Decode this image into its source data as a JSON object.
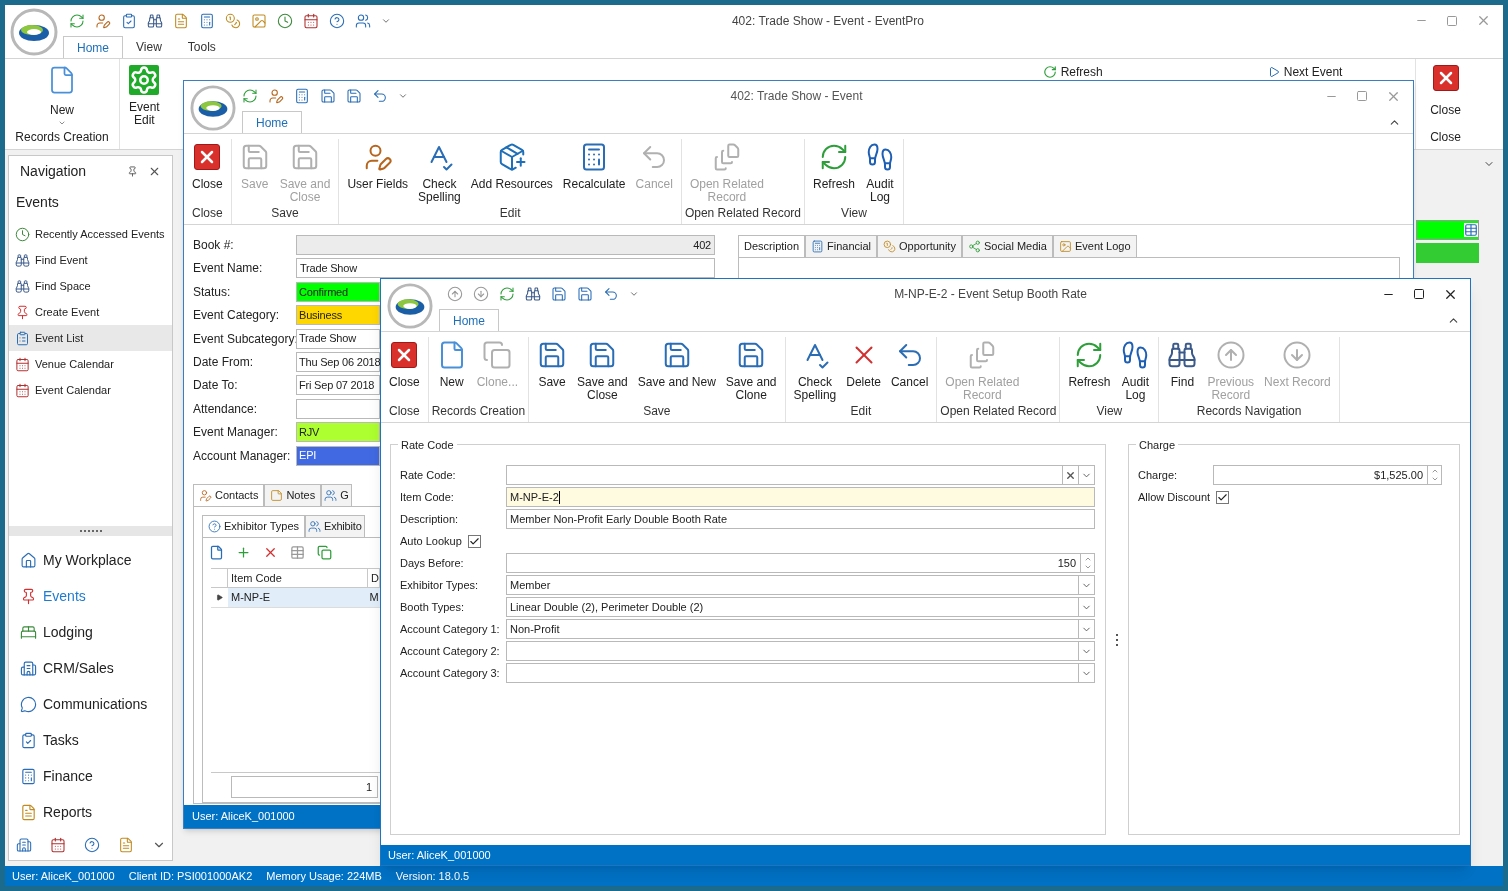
{
  "main_window": {
    "title": "402: Trade Show - Event - EventPro",
    "tabs": [
      {
        "label": "Home",
        "selected": true
      },
      {
        "label": "View",
        "selected": false
      },
      {
        "label": "Tools",
        "selected": false
      }
    ],
    "ribbon": {
      "new_button": "New",
      "records_creation": "Records Creation",
      "event_edit": "Event\nEdit",
      "refresh": "Refresh",
      "next_event": "Next Event",
      "close_button": "Close",
      "close_group": "Close"
    }
  },
  "navigation": {
    "title": "Navigation",
    "section": "Events",
    "items": [
      {
        "label": "Recently Accessed Events",
        "kind": "clock",
        "selected": false
      },
      {
        "label": "Find Event",
        "kind": "find",
        "selected": false
      },
      {
        "label": "Find Space",
        "kind": "find",
        "selected": false
      },
      {
        "label": "Create Event",
        "kind": "pin",
        "selected": false
      },
      {
        "label": "Event List",
        "kind": "list",
        "selected": true
      },
      {
        "label": "Venue Calendar",
        "kind": "calendar",
        "selected": false
      },
      {
        "label": "Event Calendar",
        "kind": "calendar",
        "selected": false
      }
    ],
    "modules": [
      {
        "label": "My Workplace",
        "kind": "home",
        "selected": false
      },
      {
        "label": "Events",
        "kind": "pin",
        "selected": true
      },
      {
        "label": "Lodging",
        "kind": "bed",
        "selected": false
      },
      {
        "label": "CRM/Sales",
        "kind": "building",
        "selected": false
      },
      {
        "label": "Communications",
        "kind": "chat",
        "selected": false
      },
      {
        "label": "Tasks",
        "kind": "tasks",
        "selected": false
      },
      {
        "label": "Finance",
        "kind": "calc",
        "selected": false
      },
      {
        "label": "Reports",
        "kind": "report",
        "selected": false
      }
    ]
  },
  "status_bar": [
    "User: AliceK_001000",
    "Client ID: PSI001000AK2",
    "Memory Usage: 224MB",
    "Version: 18.0.5"
  ],
  "event_window": {
    "title": "402: Trade Show - Event",
    "tabs": [
      {
        "label": "Home",
        "selected": true
      }
    ],
    "ribbon": [
      {
        "label": "Close",
        "buttons": [
          {
            "label": "Close",
            "kind": "close",
            "disabled": false
          }
        ]
      },
      {
        "label": "Save",
        "buttons": [
          {
            "label": "Save",
            "kind": "save",
            "disabled": true
          },
          {
            "label": "Save and\nClose",
            "kind": "saveclose",
            "disabled": true
          }
        ]
      },
      {
        "label": "Edit",
        "buttons": [
          {
            "label": "User Fields",
            "kind": "user",
            "disabled": false
          },
          {
            "label": "Check\nSpelling",
            "kind": "spell",
            "disabled": false
          },
          {
            "label": "Add Resources",
            "kind": "add",
            "disabled": false
          },
          {
            "label": "Recalculate",
            "kind": "calc",
            "disabled": false
          },
          {
            "label": "Cancel",
            "kind": "undo",
            "disabled": true
          }
        ]
      },
      {
        "label": "Open Related Record",
        "buttons": [
          {
            "label": "Open Related\nRecord",
            "kind": "related",
            "disabled": true
          }
        ]
      },
      {
        "label": "View",
        "buttons": [
          {
            "label": "Refresh",
            "kind": "refresh",
            "disabled": false
          },
          {
            "label": "Audit\nLog",
            "kind": "audit",
            "disabled": false
          }
        ]
      }
    ],
    "fields": [
      {
        "label": "Book #:",
        "value": "402",
        "disabled": true
      },
      {
        "label": "Event Name:",
        "value": "Trade Show",
        "disabled": false
      },
      {
        "label": "Status:",
        "value": "Confirmed",
        "color": "#00ff00",
        "disabled": false
      },
      {
        "label": "Event Category:",
        "value": "Business",
        "color": "#ffd700",
        "disabled": false
      },
      {
        "label": "Event Subcategory:",
        "value": "Trade Show",
        "disabled": false
      },
      {
        "label": "Date From:",
        "value": "Thu Sep 06 2018",
        "disabled": false
      },
      {
        "label": "Date To:",
        "value": "Fri Sep 07 2018",
        "disabled": false
      },
      {
        "label": "Attendance:",
        "disabled": false
      },
      {
        "label": "Event Manager:",
        "value": "RJV",
        "color": "#adff2f",
        "disabled": false
      },
      {
        "label": "Account Manager:",
        "value": "EPI",
        "color": "#4169e1",
        "disabled": false
      }
    ],
    "detail_tabs": [
      {
        "label": "Description",
        "kind": "none",
        "selected": true
      },
      {
        "label": "Financial",
        "kind": "calc",
        "selected": false
      },
      {
        "label": "Opportunity",
        "kind": "money",
        "selected": false
      },
      {
        "label": "Social Media",
        "kind": "share",
        "selected": false
      },
      {
        "label": "Event Logo",
        "kind": "image",
        "selected": false
      }
    ],
    "bottom_tabs": [
      {
        "label": "Contacts",
        "kind": "user",
        "selected": true
      },
      {
        "label": "Notes",
        "kind": "note",
        "selected": false
      },
      {
        "label": "G",
        "kind": "group",
        "selected": false
      }
    ],
    "sub_tabs": [
      {
        "label": "Exhibitor Types",
        "kind": "help",
        "selected": true
      },
      {
        "label": "Exhibito",
        "kind": "group",
        "selected": false
      }
    ],
    "grid": {
      "columns": [
        "Item Code",
        "D"
      ],
      "rows": [
        [
          "M-NP-E",
          "M"
        ]
      ],
      "footer": "1"
    },
    "status": "User: AliceK_001000"
  },
  "rate_window": {
    "title": "M-NP-E-2 - Event Setup Booth Rate",
    "tabs": [
      {
        "label": "Home",
        "selected": true
      }
    ],
    "ribbon": [
      {
        "label": "Close",
        "buttons": [
          {
            "label": "Close",
            "kind": "close",
            "disabled": false
          }
        ]
      },
      {
        "label": "Records Creation",
        "buttons": [
          {
            "label": "New",
            "kind": "new",
            "disabled": false
          },
          {
            "label": "Clone...",
            "kind": "clone",
            "disabled": true
          }
        ]
      },
      {
        "label": "Save",
        "buttons": [
          {
            "label": "Save",
            "kind": "save",
            "disabled": false
          },
          {
            "label": "Save and\nClose",
            "kind": "saveclose",
            "disabled": false
          },
          {
            "label": "Save and New",
            "kind": "savenew",
            "disabled": false
          },
          {
            "label": "Save and\nClone",
            "kind": "saveclone",
            "disabled": false
          }
        ]
      },
      {
        "label": "Edit",
        "buttons": [
          {
            "label": "Check\nSpelling",
            "kind": "spell",
            "disabled": false
          },
          {
            "label": "Delete",
            "kind": "delete",
            "disabled": false
          },
          {
            "label": "Cancel",
            "kind": "undo",
            "disabled": false
          }
        ]
      },
      {
        "label": "Open Related Record",
        "buttons": [
          {
            "label": "Open Related\nRecord",
            "kind": "related",
            "disabled": true
          }
        ]
      },
      {
        "label": "View",
        "buttons": [
          {
            "label": "Refresh",
            "kind": "refresh",
            "disabled": false
          },
          {
            "label": "Audit\nLog",
            "kind": "audit",
            "disabled": false
          }
        ]
      },
      {
        "label": "Records Navigation",
        "buttons": [
          {
            "label": "Find",
            "kind": "find",
            "disabled": false
          },
          {
            "label": "Previous\nRecord",
            "kind": "prev",
            "disabled": true
          },
          {
            "label": "Next Record",
            "kind": "next",
            "disabled": true
          }
        ]
      }
    ],
    "rate_group": {
      "title": "Rate Code",
      "fields": [
        {
          "kind": "combo",
          "label": "Rate Code:",
          "clearable": true
        },
        {
          "kind": "text",
          "label": "Item Code:",
          "value": "M-NP-E-2",
          "focused": true
        },
        {
          "kind": "text",
          "label": "Description:",
          "value": "Member Non-Profit Early Double Booth Rate",
          "focused": false
        },
        {
          "kind": "check",
          "label": "Auto Lookup",
          "checked": true
        },
        {
          "kind": "spin",
          "label": "Days Before:",
          "value": "150"
        },
        {
          "kind": "combo",
          "label": "Exhibitor Types:",
          "value": "Member",
          "clearable": false
        },
        {
          "kind": "combo",
          "label": "Booth Types:",
          "value": "Linear Double (2), Perimeter Double (2)",
          "clearable": false
        },
        {
          "kind": "combo",
          "label": "Account Category 1:",
          "value": "Non-Profit",
          "clearable": false
        },
        {
          "kind": "combo",
          "label": "Account Category 2:",
          "clearable": false
        },
        {
          "kind": "combo",
          "label": "Account Category 3:",
          "clearable": false
        }
      ]
    },
    "charge_group": {
      "title": "Charge",
      "fields": [
        {
          "kind": "spin",
          "label": "Charge:",
          "value": "$1,525.00"
        },
        {
          "kind": "check",
          "label": "Allow Discount",
          "checked": true
        }
      ]
    },
    "status": "User: AliceK_001000"
  }
}
